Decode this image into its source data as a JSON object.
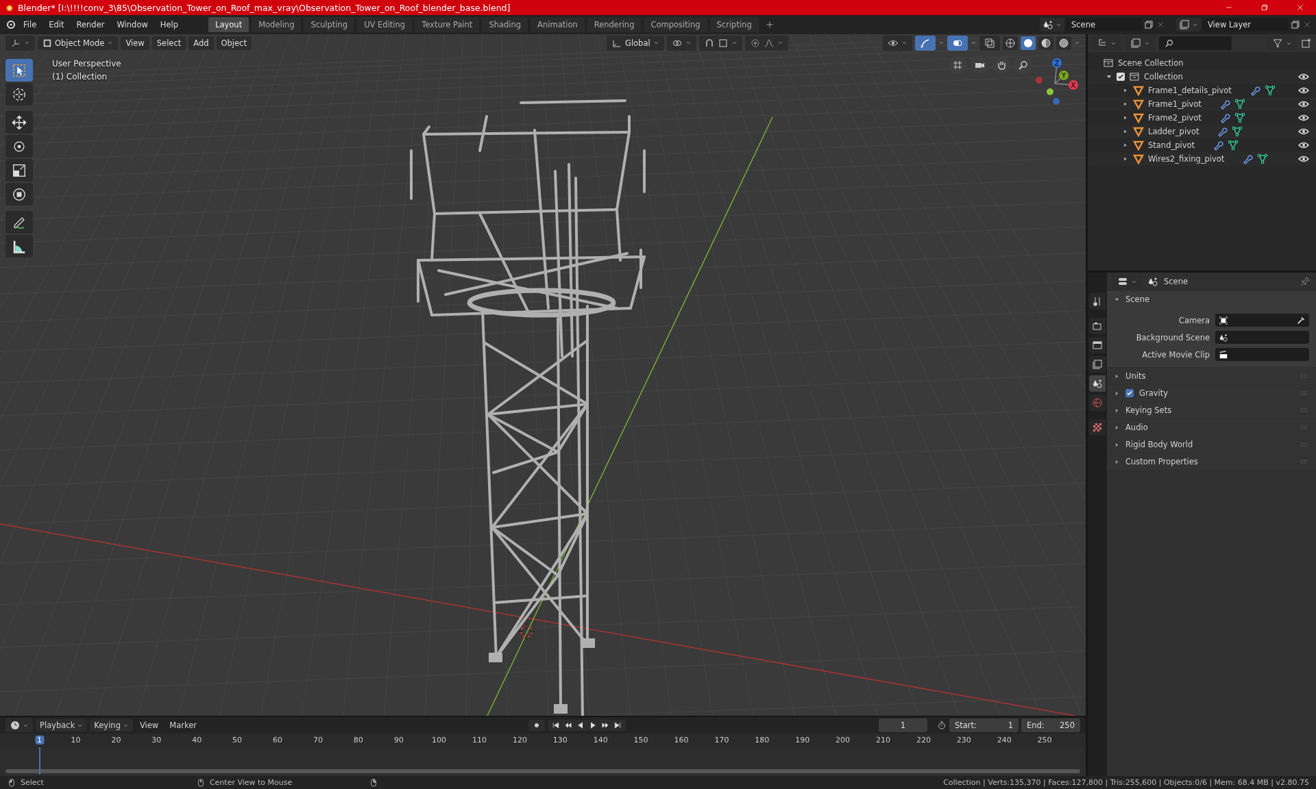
{
  "window": {
    "title": "Blender* [I:\\!!!!conv_3\\85\\Observation_Tower_on_Roof_max_vray\\Observation_Tower_on_Roof_blender_base.blend]"
  },
  "menu": [
    "File",
    "Edit",
    "Render",
    "Window",
    "Help"
  ],
  "workspaces": [
    {
      "label": "Layout",
      "selected": true
    },
    {
      "label": "Modeling",
      "selected": false
    },
    {
      "label": "Sculpting",
      "selected": false
    },
    {
      "label": "UV Editing",
      "selected": false
    },
    {
      "label": "Texture Paint",
      "selected": false
    },
    {
      "label": "Shading",
      "selected": false
    },
    {
      "label": "Animation",
      "selected": false
    },
    {
      "label": "Rendering",
      "selected": false
    },
    {
      "label": "Compositing",
      "selected": false
    },
    {
      "label": "Scripting",
      "selected": false
    }
  ],
  "scene_field": "Scene",
  "view_layer_field": "View Layer",
  "viewport": {
    "mode": "Object Mode",
    "menus": [
      "View",
      "Select",
      "Add",
      "Object"
    ],
    "orientation": "Global",
    "overlay_text": [
      "User Perspective",
      "(1) Collection"
    ],
    "tools": [
      {
        "selected": true
      },
      {
        "selected": false
      },
      {
        "selected": false
      },
      {
        "selected": false
      },
      {
        "selected": false
      },
      {
        "selected": false
      },
      {
        "selected": false
      },
      {
        "selected": false
      }
    ],
    "shading": [
      {
        "selected": false
      },
      {
        "selected": true
      },
      {
        "selected": false
      },
      {
        "selected": false
      }
    ],
    "gizmo_axes": [
      "Z",
      "Y",
      "X"
    ]
  },
  "outliner": {
    "root": "Scene Collection",
    "collection": {
      "label": "Collection",
      "checked": true,
      "expanded": true,
      "children": [
        {
          "label": "Frame1_details_pivot"
        },
        {
          "label": "Frame1_pivot"
        },
        {
          "label": "Frame2_pivot"
        },
        {
          "label": "Ladder_pivot"
        },
        {
          "label": "Stand_pivot"
        },
        {
          "label": "Wires2_fixing_pivot"
        }
      ]
    }
  },
  "properties": {
    "context": "Scene",
    "tabs": [
      {
        "selected": false
      },
      {
        "selected": false
      },
      {
        "selected": false
      },
      {
        "selected": false
      },
      {
        "selected": true
      },
      {
        "selected": false
      },
      {
        "selected": false
      }
    ],
    "panel": {
      "title": "Scene",
      "expanded": true,
      "fields": [
        {
          "label": "Camera"
        },
        {
          "label": "Background Scene"
        },
        {
          "label": "Active Movie Clip"
        }
      ]
    },
    "sections": [
      {
        "kind": "plain",
        "label": "Units"
      },
      {
        "kind": "checkbox",
        "label": "Gravity",
        "checked": true
      },
      {
        "kind": "plain",
        "label": "Keying Sets"
      },
      {
        "kind": "plain",
        "label": "Audio"
      },
      {
        "kind": "plain",
        "label": "Rigid Body World"
      },
      {
        "kind": "plain",
        "label": "Custom Properties"
      }
    ]
  },
  "timeline": {
    "menus": [
      "Playback",
      "Keying",
      "View",
      "Marker"
    ],
    "current_frame": "1",
    "start_label": "Start:",
    "start_value": "1",
    "end_label": "End:",
    "end_value": "250",
    "ruler": [
      {
        "label": "1",
        "selected": true
      },
      {
        "label": "10",
        "selected": false
      },
      {
        "label": "20",
        "selected": false
      },
      {
        "label": "30",
        "selected": false
      },
      {
        "label": "40",
        "selected": false
      },
      {
        "label": "50",
        "selected": false
      },
      {
        "label": "60",
        "selected": false
      },
      {
        "label": "70",
        "selected": false
      },
      {
        "label": "80",
        "selected": false
      },
      {
        "label": "90",
        "selected": false
      },
      {
        "label": "100",
        "selected": false
      },
      {
        "label": "110",
        "selected": false
      },
      {
        "label": "120",
        "selected": false
      },
      {
        "label": "130",
        "selected": false
      },
      {
        "label": "140",
        "selected": false
      },
      {
        "label": "150",
        "selected": false
      },
      {
        "label": "160",
        "selected": false
      },
      {
        "label": "170",
        "selected": false
      },
      {
        "label": "180",
        "selected": false
      },
      {
        "label": "190",
        "selected": false
      },
      {
        "label": "200",
        "selected": false
      },
      {
        "label": "210",
        "selected": false
      },
      {
        "label": "220",
        "selected": false
      },
      {
        "label": "230",
        "selected": false
      },
      {
        "label": "240",
        "selected": false
      },
      {
        "label": "250",
        "selected": false
      }
    ]
  },
  "status_bar": {
    "left": [
      "Select",
      "Center View to Mouse"
    ],
    "stats": "Collection | Verts:135,370 | Faces:127,800 | Tris:255,600 | Objects:0/6 | Mem: 68.4 MB | v2.80.75"
  }
}
